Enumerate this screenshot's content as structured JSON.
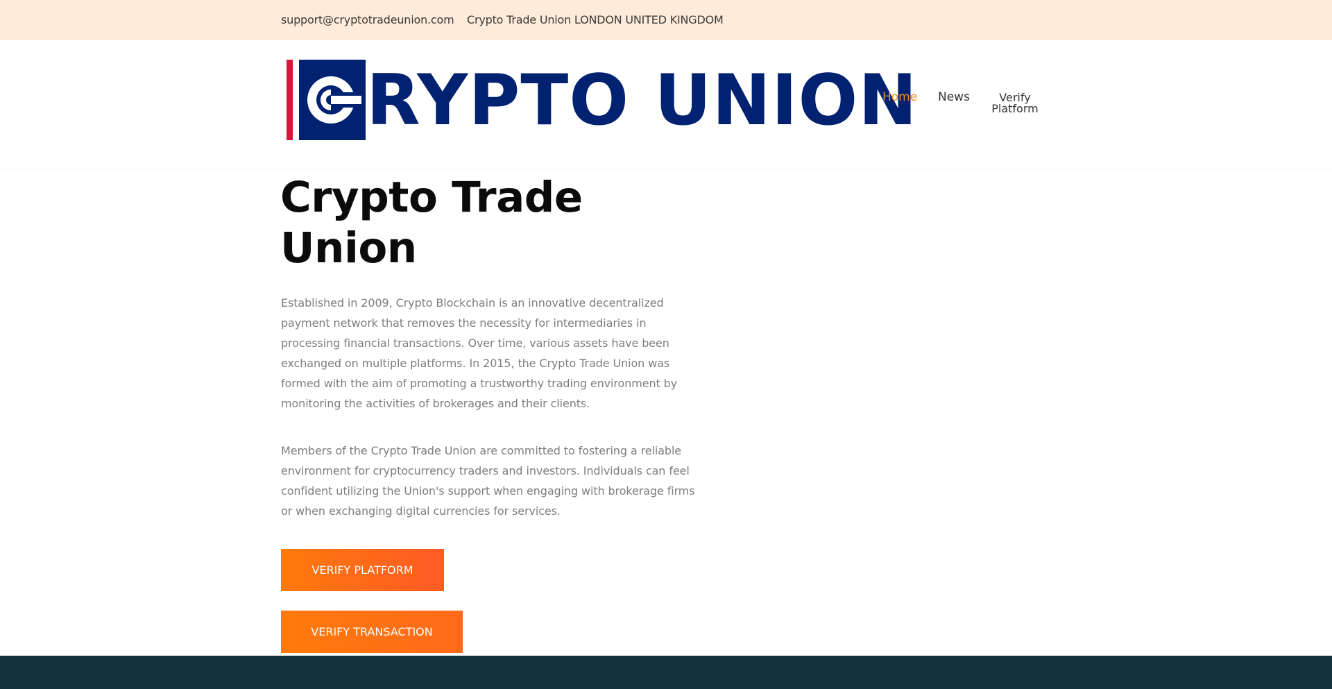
{
  "topbar": {
    "email": "support@cryptotradeunion.com",
    "address": "Crypto Trade Union LONDON UNITED KINGDOM"
  },
  "logo": {
    "wordmark": "RYPTO UNION",
    "icon": "crypto-c-icon",
    "colors": {
      "navy": "#012171",
      "red": "#d9163b"
    }
  },
  "nav": {
    "items": [
      {
        "label": "Home",
        "active": true
      },
      {
        "label": "News",
        "active": false
      },
      {
        "label": "Verify Platform",
        "active": false
      }
    ]
  },
  "hero": {
    "title": "Crypto Trade Union",
    "paragraph1": "Established in 2009, Crypto Blockchain is an innovative decentralized payment network that removes the necessity for intermediaries in processing financial transactions. Over time, various assets have been exchanged on multiple platforms. In 2015, the Crypto Trade Union was formed with the aim of promoting a trustworthy trading environment by monitoring the activities of brokerages and their clients.",
    "paragraph2": "Members of the Crypto Trade Union are committed to fostering a reliable environment for cryptocurrency traders and investors. Individuals can feel confident utilizing the Union's support when engaging with brokerage firms or when exchanging digital currencies for services.",
    "buttons": {
      "verify_platform": "VERIFY PLATFORM",
      "verify_transaction": "VERIFY TRANSACTION"
    }
  },
  "colors": {
    "topbar_bg": "#ffebd9",
    "accent": "#f28a1a",
    "button": "#ff7a0c",
    "footer_bg": "#12333e"
  }
}
